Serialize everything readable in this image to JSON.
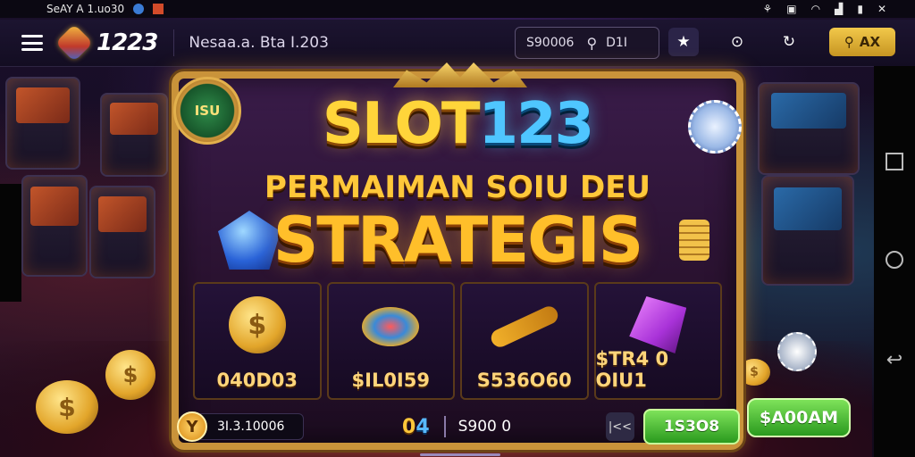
{
  "status_bar": {
    "left_text": "SeAY A 1.uo30",
    "icons": [
      "app-circle-icon",
      "app-square-icon"
    ],
    "right_icons": [
      "notification-icon",
      "app-icon",
      "wifi-icon",
      "signal-icon",
      "battery-icon",
      "close-icon"
    ]
  },
  "header": {
    "logo_text": "1223",
    "title": "Nesaa.a. Bta I.203",
    "search": {
      "value": "S90006",
      "suffix": "D1I"
    },
    "gold_button_label": "AX"
  },
  "game": {
    "badge_text": "ISU",
    "headline_line1_a": "SLOT",
    "headline_line1_b": "123",
    "headline_line2": "PERMAIMAN SOIU DEU",
    "headline_line3": "STRATEGIS",
    "reels": [
      {
        "icon": "gold-coin-icon",
        "value": "040D03"
      },
      {
        "icon": "disc-icon",
        "value": "$IL0I59"
      },
      {
        "icon": "gold-stick-icon",
        "value": "S536O60"
      },
      {
        "icon": "pink-crystal-icon",
        "value": "$TR4 0 OIU1"
      }
    ],
    "balance": "3I.3.10006",
    "balance_coin_symbol": "Y",
    "bet_level_a": "0",
    "bet_level_b": "4",
    "bet_amount": "S900 0",
    "speed_label": "|<<",
    "spin_label": "1S3O8",
    "claim_label": "$A00AM"
  },
  "colors": {
    "frame_gold": "#c9933a",
    "spin_green": "#2a9a1e",
    "gold_button": "#f2c84a",
    "header_bg": "#1c1430"
  }
}
